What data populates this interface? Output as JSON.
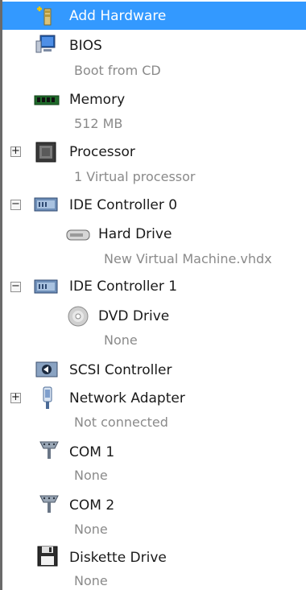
{
  "items": {
    "add_hardware": {
      "label": "Add Hardware",
      "icon": "add-hardware-icon"
    },
    "bios": {
      "label": "BIOS",
      "value": "Boot from CD",
      "icon": "bios-icon"
    },
    "memory": {
      "label": "Memory",
      "value": "512 MB",
      "icon": "memory-icon"
    },
    "processor": {
      "label": "Processor",
      "value": "1 Virtual processor",
      "icon": "processor-icon",
      "toggle": "+"
    },
    "ide0": {
      "label": "IDE Controller 0",
      "icon": "ide-controller-icon",
      "toggle": "−"
    },
    "hard_drive": {
      "label": "Hard Drive",
      "value": "New Virtual Machine.vhdx",
      "icon": "hard-drive-icon"
    },
    "ide1": {
      "label": "IDE Controller 1",
      "icon": "ide-controller-icon",
      "toggle": "−"
    },
    "dvd_drive": {
      "label": "DVD Drive",
      "value": "None",
      "icon": "dvd-icon"
    },
    "scsi": {
      "label": "SCSI Controller",
      "icon": "scsi-icon"
    },
    "network": {
      "label": "Network Adapter",
      "value": "Not connected",
      "icon": "network-adapter-icon",
      "toggle": "+"
    },
    "com1": {
      "label": "COM 1",
      "value": "None",
      "icon": "com-port-icon"
    },
    "com2": {
      "label": "COM 2",
      "value": "None",
      "icon": "com-port-icon"
    },
    "diskette": {
      "label": "Diskette Drive",
      "value": "None",
      "icon": "floppy-icon"
    }
  },
  "colors": {
    "selection": "#3399ff",
    "secondary_text": "#8a8a8a"
  }
}
